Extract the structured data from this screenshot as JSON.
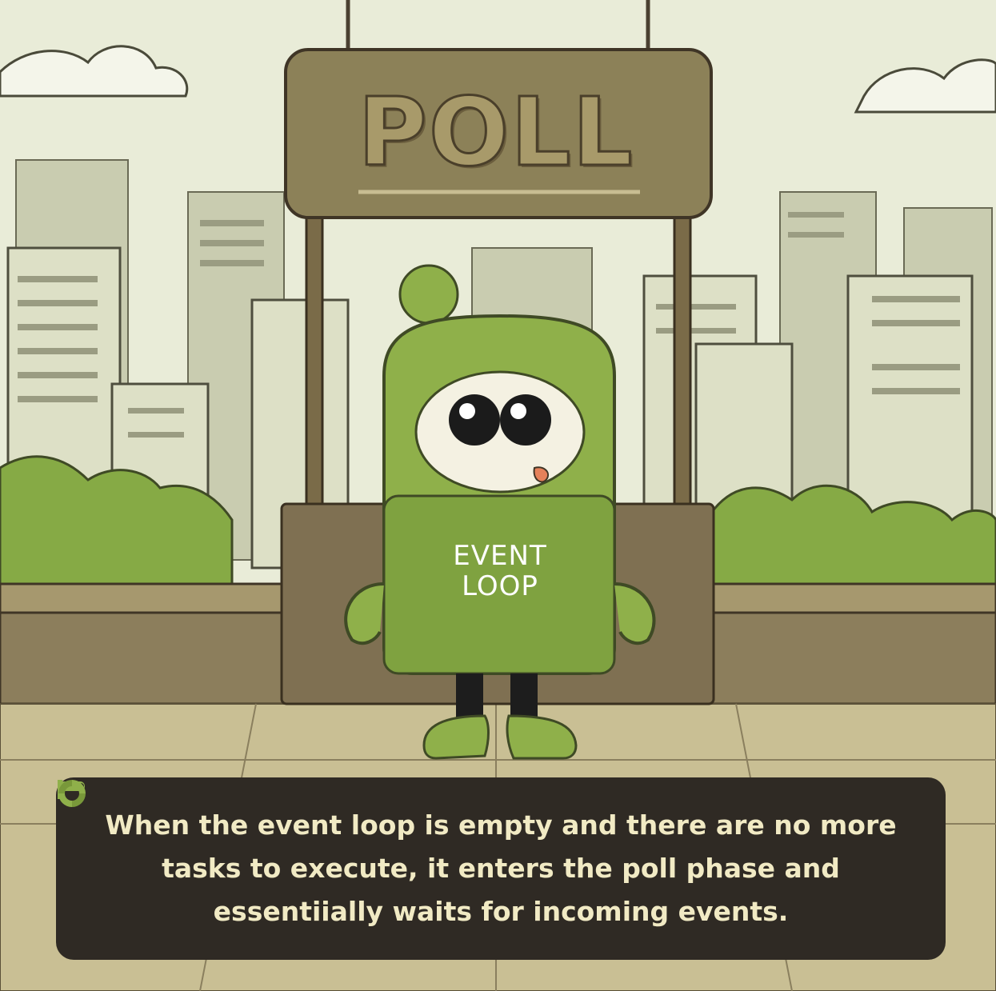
{
  "sign": {
    "text": "POLL"
  },
  "character": {
    "shirt_line1": "EVENT",
    "shirt_line2": "LOOP"
  },
  "caption": {
    "part1": "When the event loop is empty and there are no",
    "part2": "more tasks to execute, it enters",
    "part3": "the poll phase and essentiially waits for incoming events.",
    "icons": [
      "flag-icon",
      "recycle-icon"
    ]
  },
  "colors": {
    "sky": "#e9ecd8",
    "sign": "#8c8158",
    "character_green": "#8fb04a",
    "bushes": "#86aa45",
    "caption_bg": "#2f2a24",
    "caption_text": "#f1eac4"
  }
}
